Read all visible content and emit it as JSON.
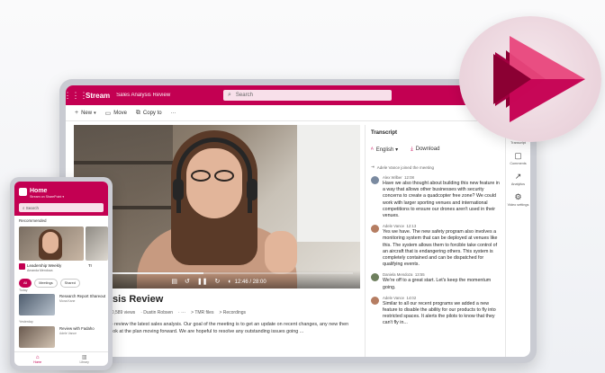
{
  "colors": {
    "brand": "#c30052",
    "brand_dark": "#8b0033",
    "brand_light": "#e8467c"
  },
  "topbar": {
    "app_name": "Stream",
    "breadcrumb": "Sales Analysis Review",
    "search_placeholder": "Search"
  },
  "cmdbar": {
    "new_label": "New",
    "move_label": "Move",
    "copy_label": "Copy to",
    "more_label": "···"
  },
  "video": {
    "time": "12:46 / 28:00",
    "progress": 0.45,
    "title": "nalysis Review",
    "meta": [
      "50,589 views",
      "· Dustin Robsen",
      "· ···",
      "> TMR files",
      "> Recordings"
    ],
    "description": "to review the latest sales analysis. Our goal of the meeting is to get an update on recent changes, any new then look at the plan moving forward. We are hopeful to resolve any outstanding issues going ..."
  },
  "transcript": {
    "title": "Transcript",
    "language": "English",
    "download": "Download",
    "joined": "Adele Vance joined the meeting",
    "entries": [
      {
        "name": "Alex Wilber",
        "time": "12:08",
        "color": "#7a8aa0",
        "text": "Have we also thought about building this new feature in a way that allows other businesses with security concerns to create a quadcopter free zone? We could work with larger sporting venues and international competitions to ensure our drones aren't used in their venues."
      },
      {
        "name": "Adele Vance",
        "time": "12:13",
        "color": "#b57d62",
        "text": "Yes we have. The new safety program also involves a monitoring system that can be deployed at venues like this. The system allows them to forcible take control of an aircraft that is endangering others. This system is completely contained and can be dispatched for qualifying events."
      },
      {
        "name": "Daniela Mendoza",
        "time": "13:55",
        "color": "#6e7f5d",
        "text": "We're off to a great start. Let's keep the momentum going."
      },
      {
        "name": "Adele Vance",
        "time": "14:02",
        "color": "#b57d62",
        "text": "Similar to all our recent programs we added a new feature to disable the ability for our products to fly into restricted spaces. It alerts the pilots to know that they can't fly in..."
      }
    ]
  },
  "rail": [
    {
      "icon": "transcript-icon",
      "label": "Transcript",
      "glyph": "☰"
    },
    {
      "icon": "comments-icon",
      "label": "Comments",
      "glyph": "▢"
    },
    {
      "icon": "analytics-icon",
      "label": "Analytics",
      "glyph": "↗"
    },
    {
      "icon": "video-settings-icon",
      "label": "Video settings",
      "glyph": "⚙"
    }
  ],
  "phone": {
    "title": "Home",
    "subtitle": "Stream on SharePoint ▾",
    "search": "Search",
    "recommended": "Recommended",
    "card_label": "Leadership Weekly",
    "card_sub": "Amanda Mendoza",
    "card2_label": "Tr",
    "pills": [
      "All",
      "Meetings",
      "Shared"
    ],
    "today": "Today",
    "yesterday": "Yesterday",
    "rows": [
      {
        "title": "Research Report Shareout",
        "sub": "Mona Kane"
      },
      {
        "title": "Review with Fadaho",
        "sub": "Adele Vance"
      }
    ],
    "tabs": [
      "Home",
      "Library"
    ]
  }
}
